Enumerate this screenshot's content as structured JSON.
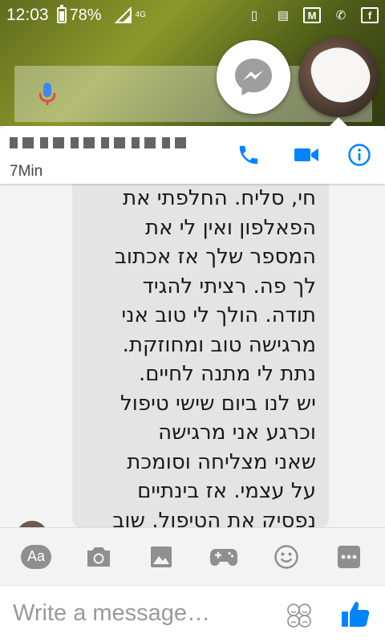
{
  "status_bar": {
    "time": "12:03",
    "battery": "78%",
    "network": "4G"
  },
  "chat": {
    "contact_name": "",
    "active_status": "7Min",
    "message_lines": [
      "חי, סליח. החלפתי את",
      "הפאלפון ואין לי את",
      "המספר שלך אז אכתוב",
      "לך פה. רציתי להגיד",
      "תודה. הולך לי טוב אני",
      "מרגישה טוב ומחוזקת.",
      "נתת לי מתנה לחיים.",
      "יש לנו ביום שישי טיפול",
      "וכרגע אני מרגישה",
      "שאני מצליחה וסומכת",
      "על עצמי. אז בינתיים",
      "נפסיק את הטיפול. שוב"
    ]
  },
  "composer": {
    "aa_label": "Aa",
    "placeholder": "Write a message…",
    "accent_color": "#0084ff"
  },
  "icons": {
    "header": [
      "phone-icon",
      "video-call-icon",
      "info-icon"
    ],
    "toolbar": [
      "aa-icon",
      "camera-icon",
      "gallery-icon",
      "game-icon",
      "emoji-icon",
      "more-icon"
    ]
  }
}
